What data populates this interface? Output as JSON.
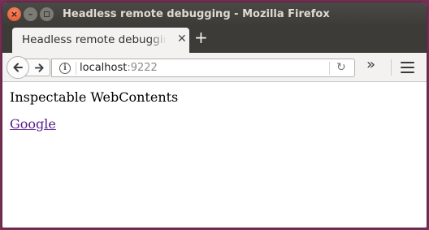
{
  "window": {
    "title": "Headless remote debugging - Mozilla Firefox"
  },
  "tab": {
    "label": "Headless remote debugging",
    "close_glyph": "✕"
  },
  "toolbar": {
    "new_tab_glyph": "+",
    "reload_glyph": "↻",
    "overflow_glyph": "»"
  },
  "address_bar": {
    "host": "localhost",
    "port": ":9222",
    "info_glyph": "i"
  },
  "page": {
    "heading": "Inspectable WebContents",
    "links": [
      {
        "label": "Google"
      }
    ]
  },
  "colors": {
    "visited_link": "#551a8b",
    "close_button": "#e0532b",
    "titlebar": "#3c3b37"
  }
}
